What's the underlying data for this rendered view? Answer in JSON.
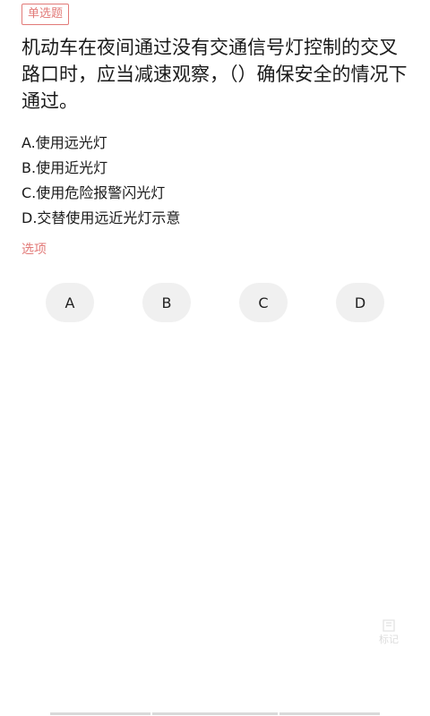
{
  "question": {
    "type_tag": "单选题",
    "text": "机动车在夜间通过没有交通信号灯控制的交叉路口时，应当减速观察，（）确保安全的情况下通过。",
    "options": [
      "A.使用远光灯",
      "B.使用近光灯",
      "C.使用危险报警闪光灯",
      "D.交替使用远近光灯示意"
    ]
  },
  "answers": {
    "section_label": "选项",
    "buttons": [
      "A",
      "B",
      "C",
      "D"
    ]
  },
  "mark": {
    "label": "标记",
    "icon": "bookmark-icon"
  },
  "colors": {
    "accent": "#e27a78",
    "button_bg": "#f0f0f0"
  }
}
